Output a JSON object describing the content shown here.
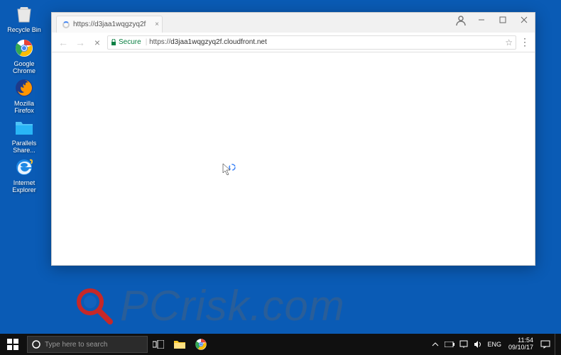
{
  "desktop": {
    "icons": [
      {
        "label": "Recycle Bin"
      },
      {
        "label": "Google Chrome"
      },
      {
        "label": "Mozilla Firefox"
      },
      {
        "label": "Parallels Share..."
      },
      {
        "label": "Internet Explorer"
      }
    ]
  },
  "browser": {
    "tab": {
      "title": "https://d3jaa1wqgzyq2f"
    },
    "secure_label": "Secure",
    "url_prefix": "https://",
    "url_domain": "d3jaa1wqgzyq2f.cloudfront.net"
  },
  "taskbar": {
    "search_placeholder": "Type here to search",
    "lang": "ENG",
    "time": "11:54",
    "date": "09/10/17"
  },
  "watermark": {
    "text": "PCrisk.com"
  }
}
